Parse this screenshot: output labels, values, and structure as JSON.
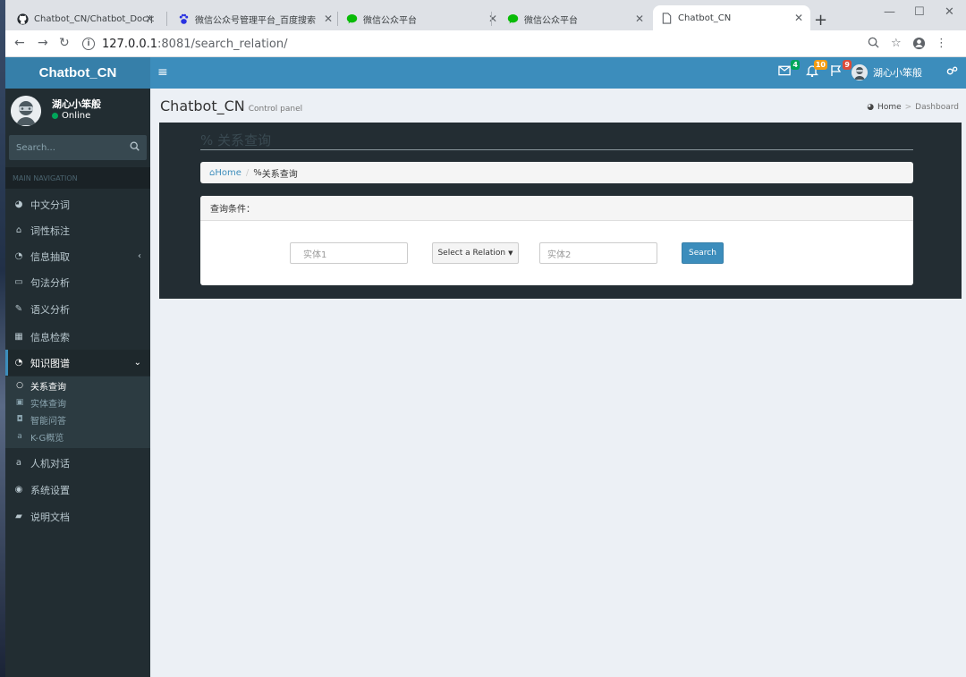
{
  "browser": {
    "tabs": [
      {
        "label": "Chatbot_CN/Chatbot_Doc/p",
        "icon": "github-icon",
        "active": false
      },
      {
        "label": "微信公众号管理平台_百度搜索",
        "icon": "baidu-paw-icon",
        "active": false
      },
      {
        "label": "微信公众平台",
        "icon": "wechat-icon",
        "active": false
      },
      {
        "label": "微信公众平台",
        "icon": "wechat-icon",
        "active": false
      },
      {
        "label": "Chatbot_CN",
        "icon": "page-icon",
        "active": true
      }
    ],
    "url_host": "127.0.0.1",
    "url_port_path": ":8081/search_relation/"
  },
  "header": {
    "logo": "Chatbot_CN",
    "mail_badge": "4",
    "notification_badge": "10",
    "flag_badge": "9",
    "user_name": "湖心小笨般",
    "colors": {
      "header": "#3c8dbc",
      "logo": "#367fa9",
      "mail_badge": "#00a65a",
      "notification_badge": "#f39c12",
      "flag_badge": "#dd4b39"
    }
  },
  "sidebar": {
    "user_name": "湖心小笨般",
    "status": "Online",
    "search_placeholder": "Search...",
    "nav_header": "MAIN NAVIGATION",
    "items": [
      {
        "label": "中文分词",
        "icon": "dashboard-icon"
      },
      {
        "label": "词性标注",
        "icon": "tag-icon"
      },
      {
        "label": "信息抽取",
        "icon": "pie-chart-icon",
        "caret": "‹"
      },
      {
        "label": "句法分析",
        "icon": "laptop-icon"
      },
      {
        "label": "语义分析",
        "icon": "edit-icon"
      },
      {
        "label": "信息检索",
        "icon": "table-icon"
      },
      {
        "label": "知识图谱",
        "icon": "pie-chart-icon",
        "caret": "⌄",
        "open": true
      },
      {
        "label": "人机对话",
        "icon": "amazon-icon"
      },
      {
        "label": "系统设置",
        "icon": "gear-circle-icon"
      },
      {
        "label": "说明文档",
        "icon": "book-icon"
      }
    ],
    "subitems": [
      {
        "label": "关系查询",
        "icon": "circle-outline-icon"
      },
      {
        "label": "实体查询",
        "icon": "id-card-icon"
      },
      {
        "label": "智能问答",
        "icon": "question-square-icon"
      },
      {
        "label": "K-G概览",
        "icon": "amazon-icon"
      }
    ]
  },
  "content": {
    "title": "Chatbot_CN",
    "subtitle": "Control panel",
    "breadcrumb_home": "Home",
    "breadcrumb_current": "Dashboard",
    "panel_title": "关系查询",
    "crumb_home": "Home",
    "crumb_current": "关系查询",
    "query_header": "查询条件：",
    "entity1_placeholder": "实体1",
    "relation_label": "Select a Relation",
    "entity2_placeholder": "实体2",
    "search_label": "Search"
  }
}
